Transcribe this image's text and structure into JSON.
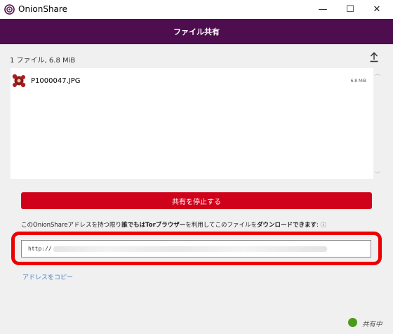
{
  "window": {
    "title": "OnionShare",
    "minimize_glyph": "—",
    "maximize_glyph": "☐",
    "close_glyph": "✕"
  },
  "header": {
    "title": "ファイル共有"
  },
  "files": {
    "summary": "1 ファイル, 6.8 MiB",
    "items": [
      {
        "name": "P1000047.JPG",
        "size": "6.8 MiB"
      }
    ]
  },
  "actions": {
    "stop_label": "共有を停止する",
    "copy_label": "アドレスをコピー"
  },
  "info": {
    "part1": "このOnionShareアドレスを持つ限り",
    "bold1": "誰でもはTorブラウザー",
    "part2": "を利用してこのファイルを",
    "bold2": "ダウンロードできます",
    "part3": ": ",
    "icon": "ⓘ"
  },
  "url": {
    "value": "http://"
  },
  "status": {
    "text": "共有中",
    "color": "#4c9a1a"
  },
  "colors": {
    "header": "#4e0d4e",
    "stop_button": "#d0011b",
    "highlight": "#ee0000",
    "link": "#4e7fc8"
  }
}
